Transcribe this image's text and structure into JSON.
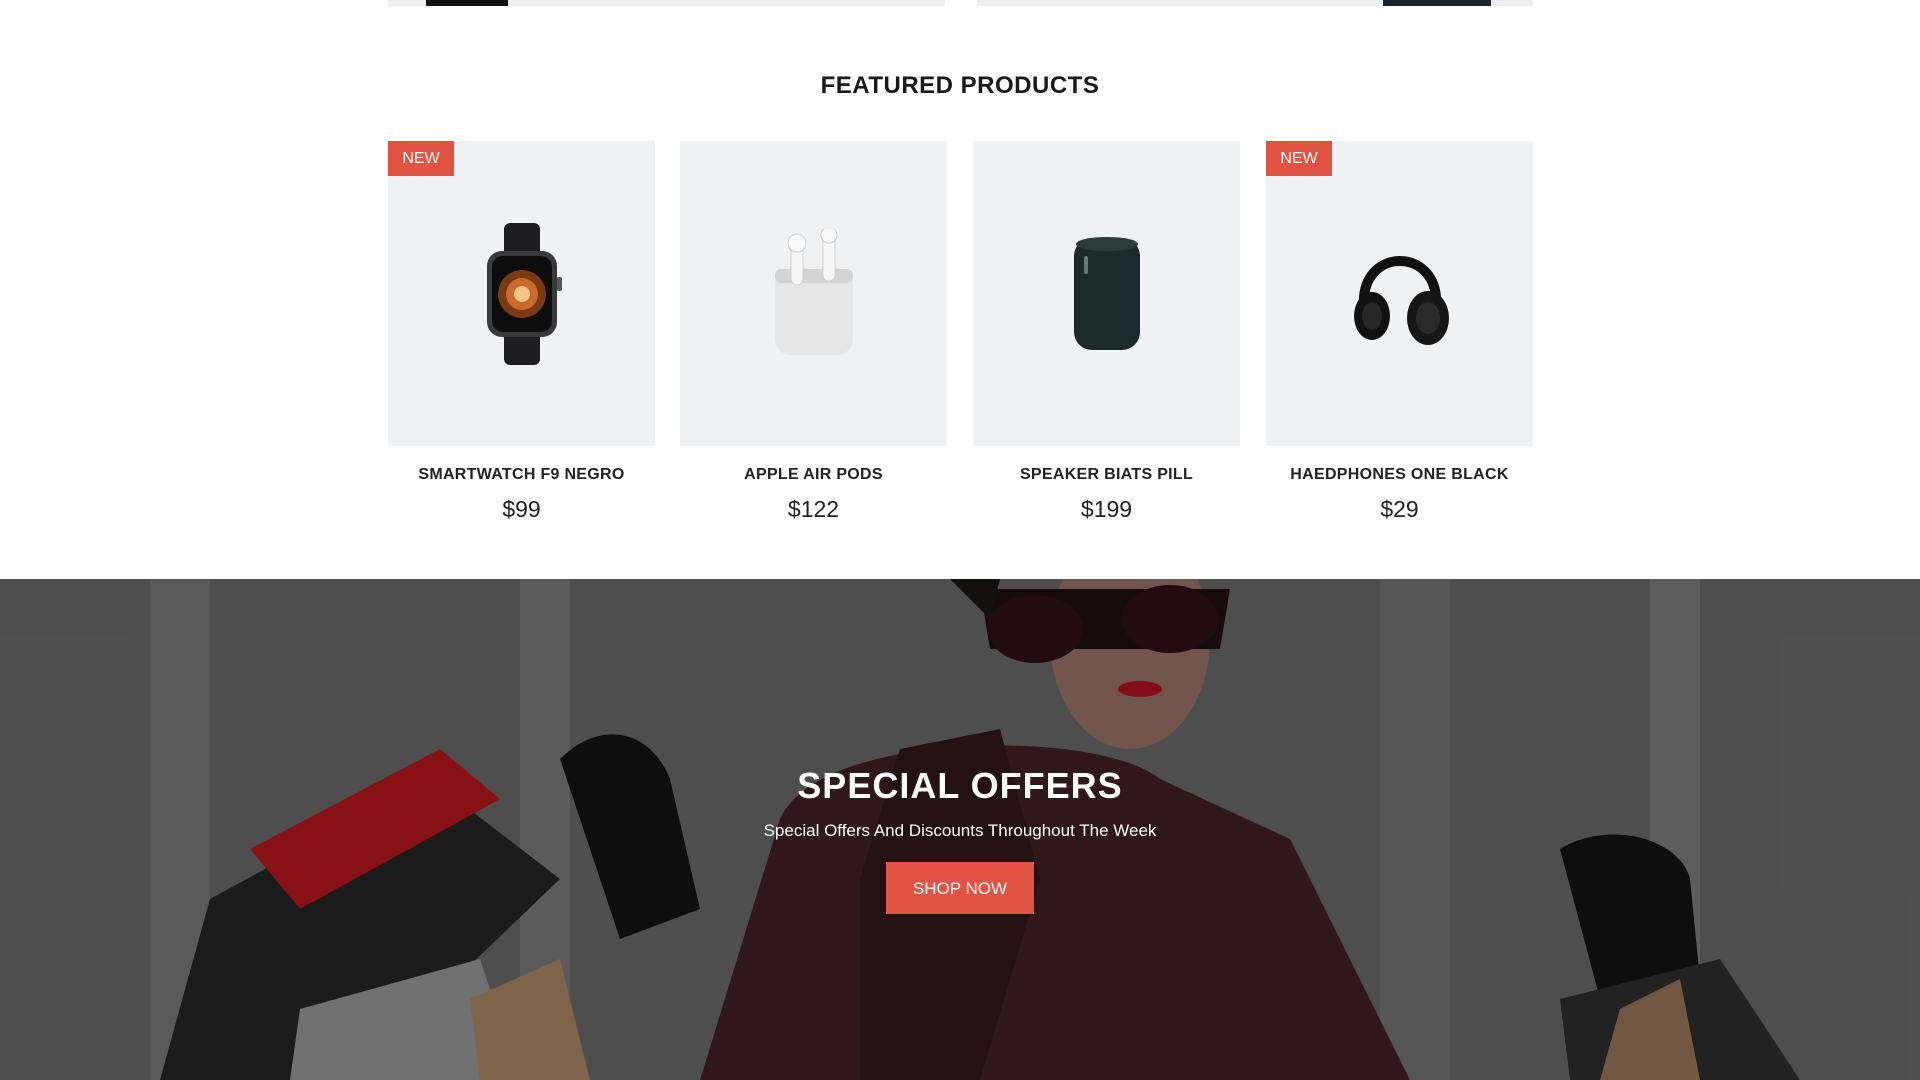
{
  "featured": {
    "title": "FEATURED PRODUCTS",
    "products": [
      {
        "name": "SMARTWATCH F9 NEGRO",
        "price": "$99",
        "badge": "NEW",
        "icon": "smartwatch-icon"
      },
      {
        "name": "APPLE AIR PODS",
        "price": "$122",
        "badge": "",
        "icon": "airpods-icon"
      },
      {
        "name": "SPEAKER BIATS PILL",
        "price": "$199",
        "badge": "",
        "icon": "speaker-icon"
      },
      {
        "name": "HAEDPHONES ONE BLACK",
        "price": "$29",
        "badge": "NEW",
        "icon": "headphones-icon"
      }
    ]
  },
  "offers": {
    "title": "SPECIAL OFFERS",
    "subtitle": "Special Offers And Discounts Throughout The Week",
    "button_label": "SHOP NOW"
  },
  "colors": {
    "accent": "#e15443",
    "card_bg": "#f0f1f3"
  }
}
